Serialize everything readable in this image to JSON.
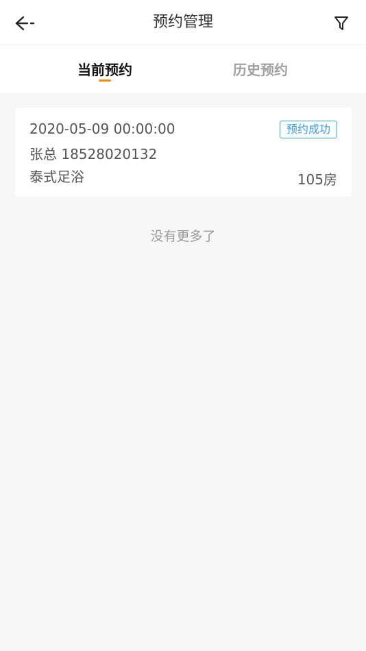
{
  "header": {
    "title": "预约管理",
    "back_icon": "arrow-left-icon",
    "filter_icon": "filter-icon"
  },
  "tabs": [
    {
      "label": "当前预约",
      "active": true
    },
    {
      "label": "历史预约",
      "active": false
    }
  ],
  "colors": {
    "accent": "#f08c00",
    "status": "#3a9be8",
    "background": "#f7f7f7"
  },
  "appointments": [
    {
      "datetime": "2020-05-09 00:00:00",
      "status": "预约成功",
      "customer": "张总 18528020132",
      "service": "泰式足浴",
      "room": "105房"
    }
  ],
  "list_end_text": "没有更多了"
}
